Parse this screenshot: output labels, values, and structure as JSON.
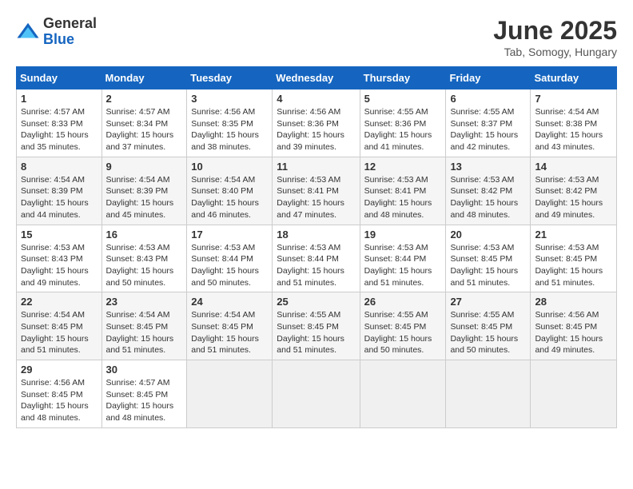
{
  "logo": {
    "general": "General",
    "blue": "Blue"
  },
  "title": "June 2025",
  "subtitle": "Tab, Somogy, Hungary",
  "days_header": [
    "Sunday",
    "Monday",
    "Tuesday",
    "Wednesday",
    "Thursday",
    "Friday",
    "Saturday"
  ],
  "weeks": [
    [
      {
        "day": "1",
        "info": "Sunrise: 4:57 AM\nSunset: 8:33 PM\nDaylight: 15 hours\nand 35 minutes."
      },
      {
        "day": "2",
        "info": "Sunrise: 4:57 AM\nSunset: 8:34 PM\nDaylight: 15 hours\nand 37 minutes."
      },
      {
        "day": "3",
        "info": "Sunrise: 4:56 AM\nSunset: 8:35 PM\nDaylight: 15 hours\nand 38 minutes."
      },
      {
        "day": "4",
        "info": "Sunrise: 4:56 AM\nSunset: 8:36 PM\nDaylight: 15 hours\nand 39 minutes."
      },
      {
        "day": "5",
        "info": "Sunrise: 4:55 AM\nSunset: 8:36 PM\nDaylight: 15 hours\nand 41 minutes."
      },
      {
        "day": "6",
        "info": "Sunrise: 4:55 AM\nSunset: 8:37 PM\nDaylight: 15 hours\nand 42 minutes."
      },
      {
        "day": "7",
        "info": "Sunrise: 4:54 AM\nSunset: 8:38 PM\nDaylight: 15 hours\nand 43 minutes."
      }
    ],
    [
      {
        "day": "8",
        "info": "Sunrise: 4:54 AM\nSunset: 8:39 PM\nDaylight: 15 hours\nand 44 minutes."
      },
      {
        "day": "9",
        "info": "Sunrise: 4:54 AM\nSunset: 8:39 PM\nDaylight: 15 hours\nand 45 minutes."
      },
      {
        "day": "10",
        "info": "Sunrise: 4:54 AM\nSunset: 8:40 PM\nDaylight: 15 hours\nand 46 minutes."
      },
      {
        "day": "11",
        "info": "Sunrise: 4:53 AM\nSunset: 8:41 PM\nDaylight: 15 hours\nand 47 minutes."
      },
      {
        "day": "12",
        "info": "Sunrise: 4:53 AM\nSunset: 8:41 PM\nDaylight: 15 hours\nand 48 minutes."
      },
      {
        "day": "13",
        "info": "Sunrise: 4:53 AM\nSunset: 8:42 PM\nDaylight: 15 hours\nand 48 minutes."
      },
      {
        "day": "14",
        "info": "Sunrise: 4:53 AM\nSunset: 8:42 PM\nDaylight: 15 hours\nand 49 minutes."
      }
    ],
    [
      {
        "day": "15",
        "info": "Sunrise: 4:53 AM\nSunset: 8:43 PM\nDaylight: 15 hours\nand 49 minutes."
      },
      {
        "day": "16",
        "info": "Sunrise: 4:53 AM\nSunset: 8:43 PM\nDaylight: 15 hours\nand 50 minutes."
      },
      {
        "day": "17",
        "info": "Sunrise: 4:53 AM\nSunset: 8:44 PM\nDaylight: 15 hours\nand 50 minutes."
      },
      {
        "day": "18",
        "info": "Sunrise: 4:53 AM\nSunset: 8:44 PM\nDaylight: 15 hours\nand 51 minutes."
      },
      {
        "day": "19",
        "info": "Sunrise: 4:53 AM\nSunset: 8:44 PM\nDaylight: 15 hours\nand 51 minutes."
      },
      {
        "day": "20",
        "info": "Sunrise: 4:53 AM\nSunset: 8:45 PM\nDaylight: 15 hours\nand 51 minutes."
      },
      {
        "day": "21",
        "info": "Sunrise: 4:53 AM\nSunset: 8:45 PM\nDaylight: 15 hours\nand 51 minutes."
      }
    ],
    [
      {
        "day": "22",
        "info": "Sunrise: 4:54 AM\nSunset: 8:45 PM\nDaylight: 15 hours\nand 51 minutes."
      },
      {
        "day": "23",
        "info": "Sunrise: 4:54 AM\nSunset: 8:45 PM\nDaylight: 15 hours\nand 51 minutes."
      },
      {
        "day": "24",
        "info": "Sunrise: 4:54 AM\nSunset: 8:45 PM\nDaylight: 15 hours\nand 51 minutes."
      },
      {
        "day": "25",
        "info": "Sunrise: 4:55 AM\nSunset: 8:45 PM\nDaylight: 15 hours\nand 51 minutes."
      },
      {
        "day": "26",
        "info": "Sunrise: 4:55 AM\nSunset: 8:45 PM\nDaylight: 15 hours\nand 50 minutes."
      },
      {
        "day": "27",
        "info": "Sunrise: 4:55 AM\nSunset: 8:45 PM\nDaylight: 15 hours\nand 50 minutes."
      },
      {
        "day": "28",
        "info": "Sunrise: 4:56 AM\nSunset: 8:45 PM\nDaylight: 15 hours\nand 49 minutes."
      }
    ],
    [
      {
        "day": "29",
        "info": "Sunrise: 4:56 AM\nSunset: 8:45 PM\nDaylight: 15 hours\nand 48 minutes."
      },
      {
        "day": "30",
        "info": "Sunrise: 4:57 AM\nSunset: 8:45 PM\nDaylight: 15 hours\nand 48 minutes."
      },
      {
        "day": "",
        "info": ""
      },
      {
        "day": "",
        "info": ""
      },
      {
        "day": "",
        "info": ""
      },
      {
        "day": "",
        "info": ""
      },
      {
        "day": "",
        "info": ""
      }
    ]
  ]
}
